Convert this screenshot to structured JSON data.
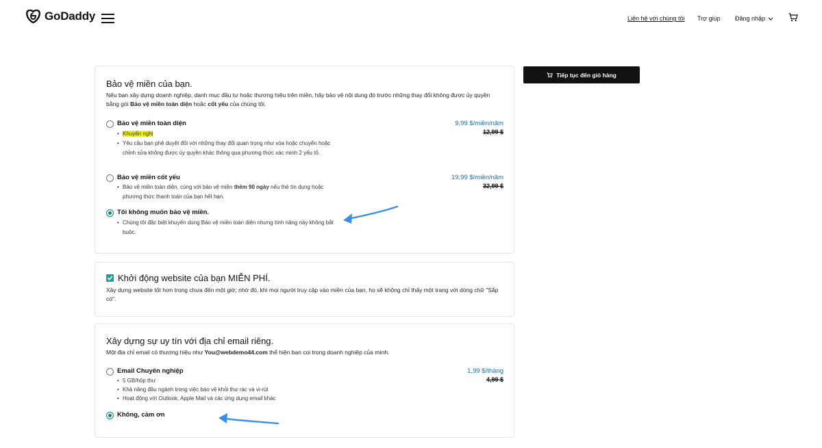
{
  "header": {
    "logo_text": "GoDaddy",
    "contact_link": "Liên hệ với chúng tôi",
    "help_link": "Trợ giúp",
    "login_label": "Đăng nhập",
    "icons": [
      "godaddy-logo-icon",
      "hamburger-menu-icon",
      "chevron-down-icon",
      "cart-icon"
    ]
  },
  "checkout_button": "Tiếp tục đến giỏ hàng",
  "domain_protection": {
    "title": "Bảo vệ miền của bạn.",
    "desc_1": "Nếu bạn xây dựng doanh nghiệp, danh mục đầu tư hoặc thương hiệu trên miền, hãy bảo vệ nội dung đó trước những thay đổi không được ủy quyền bằng gói ",
    "desc_bold_1": "Bảo vệ miền toàn diện",
    "desc_2": " hoặc ",
    "desc_bold_2": "cốt yếu",
    "desc_3": " của chúng tôi.",
    "options": [
      {
        "title": "Bảo vệ miền toàn diện",
        "badge": "Khuyến nghị",
        "bullets": [
          "Yêu cầu bạn phê duyệt đối với những thay đổi quan trọng như xóa hoặc chuyển hoặc chỉnh sửa không được ủy quyền khác thông qua phương thức xác minh 2 yếu tố."
        ],
        "price": "9,99 $/miền/năm",
        "old_price": "12,99 $",
        "selected": false
      },
      {
        "title": "Bảo vệ miền cốt yếu",
        "bullet_a": "Bảo vệ miền toàn diện, cùng với bảo vệ miền ",
        "bullet_bold": "thêm 90 ngày",
        "bullet_b": " nếu thẻ tín dụng hoặc phương thức thanh toán của bạn hết hạn.",
        "price": "19,99 $/miền/năm",
        "old_price": "32,99 $",
        "selected": false
      },
      {
        "title": "Tôi không muốn bảo vệ miền.",
        "bullets": [
          "Chúng tôi đặc biệt khuyến dùng Bảo vệ miền toàn diện nhưng tính năng này không bắt buộc."
        ],
        "selected": true
      }
    ]
  },
  "website": {
    "title": "Khởi động website của bạn MIỄN PHÍ.",
    "desc": "Xây dựng website tốt hơn trong chưa đến một giờ; nhờ đó, khi mọi người truy cập vào miền của bạn, họ sẽ không chỉ thấy một trang với dòng chữ \"Sắp có\".",
    "checked": true
  },
  "email": {
    "title": "Xây dựng sự uy tín với địa chỉ email riêng.",
    "desc_a": "Một địa chỉ email có thương hiệu như ",
    "desc_bold": "You@webdemo44.com",
    "desc_b": " thể hiện bạn coi trọng doanh nghiệp của mình.",
    "options": [
      {
        "title": "Email Chuyên nghiệp",
        "bullets": [
          "5 GB/hộp thư",
          "Khả năng đầu ngành trong việc bảo vệ khỏi thư rác và vi-rút",
          "Hoạt động với Outlook, Apple Mail và các ứng dụng email khác"
        ],
        "price": "1,99 $/tháng",
        "old_price": "4,99 $",
        "selected": false
      },
      {
        "title": "Không, cảm ơn",
        "selected": true
      }
    ]
  },
  "colors": {
    "accent_teal": "#13807a",
    "price_blue": "#1a6fa3",
    "highlight_yellow": "#f2f211",
    "annotation_arrow": "#3a8ee6"
  }
}
